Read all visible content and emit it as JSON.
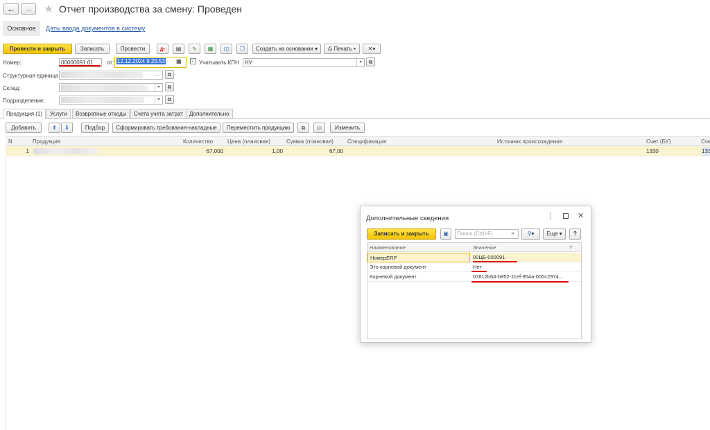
{
  "window": {
    "title": "Отчет производства за смену: Проведен",
    "back_icon": "←",
    "forward_icon": "→",
    "star_icon": "★"
  },
  "nav": {
    "main_label": "Основное",
    "link_label": "Даты ввода документов в систему"
  },
  "toolbar": {
    "post_close": "Провести и закрыть",
    "save": "Записать",
    "post": "Провести",
    "create_based": "Создать на основании",
    "print": "Печать"
  },
  "form": {
    "number_label": "Номер:",
    "number_value": "00000091.01",
    "date_label": "от:",
    "date_value": "12.12.2024  9:25:53",
    "kpn_label": "Учитывать КПН",
    "kpn_value": "НУ",
    "unit_label": "Структурная единица:",
    "warehouse_label": "Склад:",
    "division_label": "Подразделение:"
  },
  "tabs": [
    "Продукция (1)",
    "Услуги",
    "Возвратные отходы",
    "Счета учета затрат",
    "Дополнительно"
  ],
  "table_toolbar": {
    "add": "Добавить",
    "pick": "Подбор",
    "form_req": "Сформировать требования-накладные",
    "move": "Переместить продукцию",
    "change": "Изменить"
  },
  "table": {
    "headers": [
      "N",
      "Продукция",
      "Количество",
      "Цена (плановая)",
      "Сумма (плановая)",
      "Спецификация",
      "Источник происхождения",
      "Счет (БУ)",
      "Сче"
    ],
    "row": {
      "n": "1",
      "qty": "67,000",
      "price": "1,00",
      "sum": "67,00",
      "account": "1330",
      "account2": "133"
    }
  },
  "dialog": {
    "title": "Дополнительные сведения",
    "save_close": "Записать и закрыть",
    "search_placeholder": "Поиск (Ctrl+F)",
    "more": "Еще",
    "help": "?",
    "headers": [
      "Наименование",
      "Значение",
      "?"
    ],
    "rows": [
      {
        "name": "НомерERP",
        "value": "00ЦБ-000091"
      },
      {
        "name": "Это корневой документ",
        "value": "Нет"
      },
      {
        "name": "Корневой документ",
        "value": "07812b64-b852-11ef-854a-000c2974..."
      }
    ]
  },
  "colors": {
    "accent_yellow": "#f2c500",
    "row_highlight": "#fbf3cf",
    "annotation_red": "#dd0000",
    "link_blue": "#2a5ea8"
  }
}
